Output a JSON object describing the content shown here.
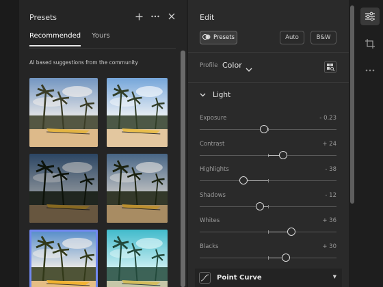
{
  "presets_panel": {
    "title": "Presets",
    "icons": [
      "add-icon",
      "more-icon",
      "close-icon"
    ],
    "tabs": [
      {
        "label": "Recommended",
        "active": true
      },
      {
        "label": "Yours",
        "active": false
      }
    ],
    "ai_note": "AI based suggestions from the community",
    "thumbnails": [
      {
        "name": "preset-thumb-1",
        "tone": "warm",
        "selected": false
      },
      {
        "name": "preset-thumb-2",
        "tone": "bright",
        "selected": false
      },
      {
        "name": "preset-thumb-3",
        "tone": "dark",
        "selected": false
      },
      {
        "name": "preset-thumb-4",
        "tone": "moody",
        "selected": false
      },
      {
        "name": "preset-thumb-5",
        "tone": "vivid",
        "selected": true
      },
      {
        "name": "preset-thumb-6",
        "tone": "cyan",
        "selected": false
      }
    ],
    "selection_color": "#7189f0"
  },
  "edit_panel": {
    "title": "Edit",
    "buttons": {
      "presets": "Presets",
      "auto": "Auto",
      "bw": "B&W"
    },
    "profile_label": "Profile",
    "profile_value": "Color",
    "section": "Light",
    "sliders": [
      {
        "label": "Exposure",
        "value_text": "- 0.23",
        "position": 0.47
      },
      {
        "label": "Contrast",
        "value_text": "+ 24",
        "position": 0.61
      },
      {
        "label": "Highlights",
        "value_text": "- 38",
        "position": 0.32
      },
      {
        "label": "Shadows",
        "value_text": "- 12",
        "position": 0.44
      },
      {
        "label": "Whites",
        "value_text": "+ 36",
        "position": 0.67
      },
      {
        "label": "Blacks",
        "value_text": "+ 30",
        "position": 0.63
      }
    ],
    "point_curve_label": "Point Curve"
  },
  "toolbar": {
    "items": [
      "adjust-icon",
      "crop-icon",
      "more-icon"
    ],
    "active": "adjust-icon"
  }
}
